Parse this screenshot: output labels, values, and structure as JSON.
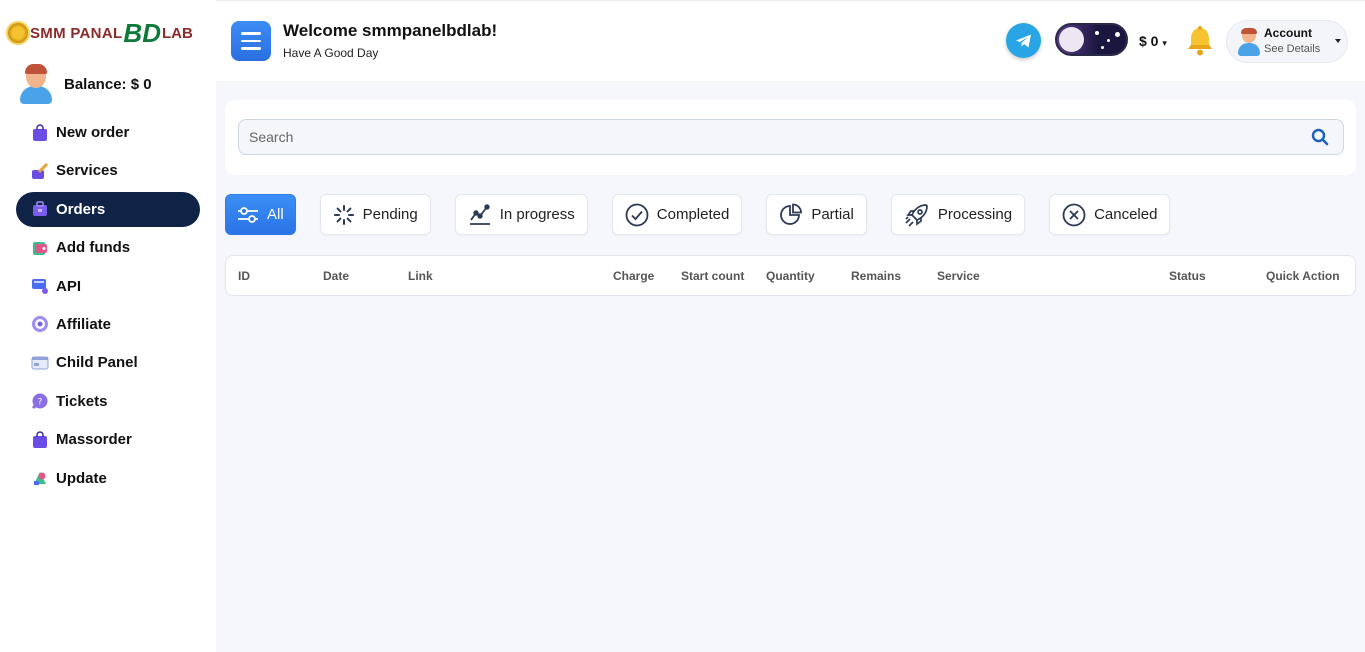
{
  "brand": {
    "logo_left": "SMM PANAL",
    "logo_mid": "BD",
    "logo_right": "LAB"
  },
  "sidebar": {
    "balance": "Balance: $ 0",
    "items": [
      {
        "label": "New order",
        "icon": "shopping-bag-icon",
        "color": "#6b4de6"
      },
      {
        "label": "Services",
        "icon": "services-icon",
        "color": "#e8a23a"
      },
      {
        "label": "Orders",
        "icon": "orders-icon",
        "color": "#7b5cf0",
        "active": true
      },
      {
        "label": "Add funds",
        "icon": "wallet-icon",
        "color": "#3cbf8a"
      },
      {
        "label": "API",
        "icon": "api-icon",
        "color": "#4a6cf0"
      },
      {
        "label": "Affiliate",
        "icon": "target-icon",
        "color": "#7b61e8"
      },
      {
        "label": "Child Panel",
        "icon": "panel-icon",
        "color": "#8fa3d9"
      },
      {
        "label": "Tickets",
        "icon": "chat-icon",
        "color": "#8a6ee8"
      },
      {
        "label": "Massorder",
        "icon": "shopping-bag-icon",
        "color": "#6b4de6"
      },
      {
        "label": "Update",
        "icon": "update-icon",
        "color": "#e0588a"
      }
    ]
  },
  "header": {
    "title": "Welcome smmpanelbdlab!",
    "subtitle": "Have A Good Day",
    "balance": "$ 0",
    "account_title": "Account",
    "account_sub": "See Details"
  },
  "search": {
    "placeholder": "Search"
  },
  "filters": [
    {
      "label": "All",
      "icon": "sliders-icon",
      "active": true
    },
    {
      "label": "Pending",
      "icon": "spinner-icon"
    },
    {
      "label": "In progress",
      "icon": "chart-line-icon"
    },
    {
      "label": "Completed",
      "icon": "check-circle-icon"
    },
    {
      "label": "Partial",
      "icon": "pie-icon"
    },
    {
      "label": "Processing",
      "icon": "rocket-icon"
    },
    {
      "label": "Canceled",
      "icon": "x-circle-icon"
    }
  ],
  "table": {
    "columns": [
      "ID",
      "Date",
      "Link",
      "Charge",
      "Start count",
      "Quantity",
      "Remains",
      "Service",
      "Status",
      "Quick Action"
    ]
  },
  "colors": {
    "accent": "#2f7ce9",
    "sidebar_active": "#0e2345",
    "background": "#f5f7fd"
  }
}
